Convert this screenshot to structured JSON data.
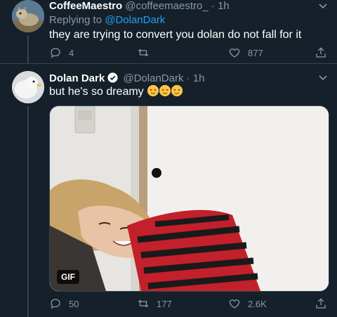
{
  "tweet1": {
    "display_name": "CoffeeMaestro",
    "handle": "@coffeemaestro_",
    "separator": "·",
    "time": "1h",
    "replying_prefix": "Replying to ",
    "replying_to": "@DolanDark",
    "text": "they are trying to convert you dolan do not fall for it",
    "replies": "4",
    "retweets": "",
    "likes": "877"
  },
  "tweet2": {
    "display_name": "Dolan Dark",
    "handle": "@DolanDark",
    "separator": "·",
    "time": "1h",
    "text": "but he's so dreamy",
    "emojis": [
      "smiling-face-with-heart-eyes",
      "smiling-face-with-heart-eyes",
      "smiling-face-with-heart-eyes"
    ],
    "media_badge": "GIF",
    "replies": "50",
    "retweets": "177",
    "likes": "2.6K"
  },
  "colors": {
    "background": "#15202b",
    "secondary_text": "#8899a6",
    "link": "#1da1f2",
    "divider": "#38444d"
  }
}
